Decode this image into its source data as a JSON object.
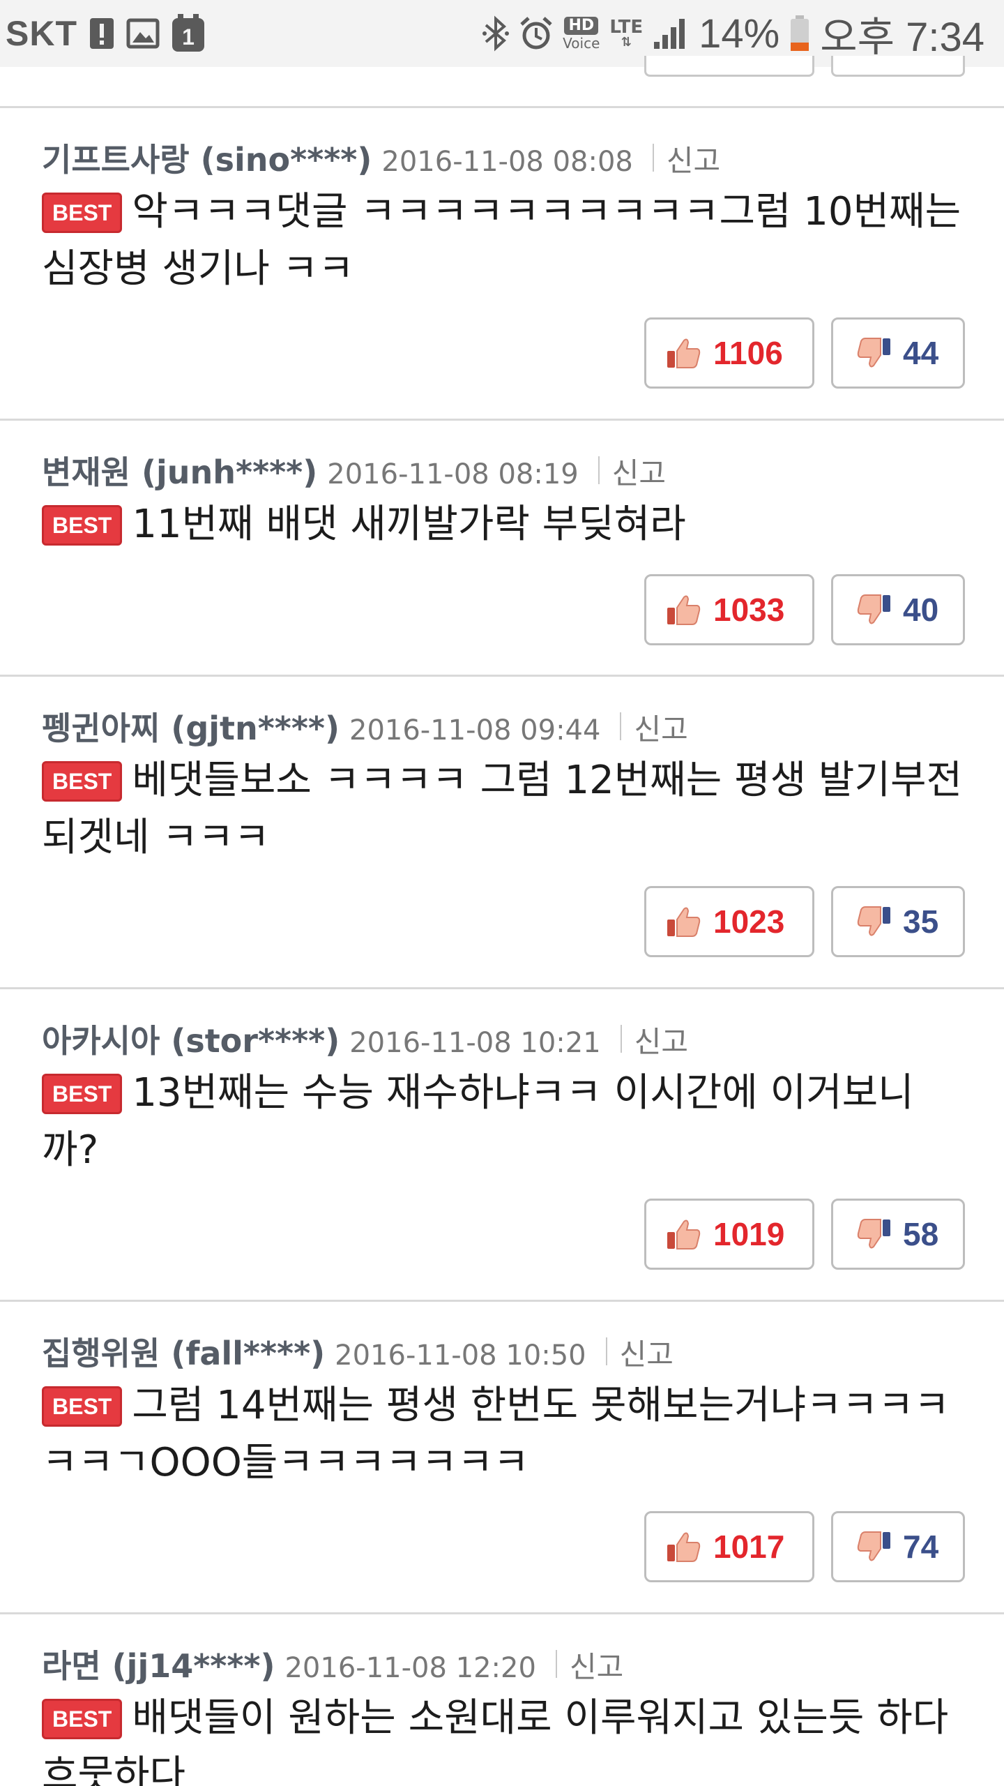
{
  "status_bar": {
    "carrier": "SKT",
    "battery_percent": "14%",
    "time": "오후 7:34",
    "hd_label": "HD",
    "voice_label": "Voice",
    "network_label": "LTE",
    "icons": [
      "warning-icon",
      "gallery-icon",
      "notification-icon",
      "bluetooth-icon",
      "alarm-icon",
      "signal-icon",
      "battery-icon"
    ]
  },
  "comments": [
    {
      "nick": "기프트사랑 (sino****)",
      "date": "2016-11-08 08:08",
      "report": "신고",
      "badge": "BEST",
      "text": "악ㅋㅋㅋ댓글 ㅋㅋㅋㅋㅋㅋㅋㅋㅋㅋ그럼 10번째는 심장병 생기나 ㅋㅋ",
      "likes": "1106",
      "dislikes": "44"
    },
    {
      "nick": "변재원 (junh****)",
      "date": "2016-11-08 08:19",
      "report": "신고",
      "badge": "BEST",
      "text": "11번째 배댓 새끼발가락 부딪혀라",
      "likes": "1033",
      "dislikes": "40"
    },
    {
      "nick": "펭귄아찌 (gjtn****)",
      "date": "2016-11-08 09:44",
      "report": "신고",
      "badge": "BEST",
      "text": "베댓들보소 ㅋㅋㅋㅋ 그럼 12번째는 평생 발기부전 되겟네 ㅋㅋㅋ",
      "likes": "1023",
      "dislikes": "35"
    },
    {
      "nick": "아카시아 (stor****)",
      "date": "2016-11-08 10:21",
      "report": "신고",
      "badge": "BEST",
      "text": "13번째는 수능 재수하냐ㅋㅋ 이시간에 이거보니까?",
      "likes": "1019",
      "dislikes": "58"
    },
    {
      "nick": "집행위원 (fall****)",
      "date": "2016-11-08 10:50",
      "report": "신고",
      "badge": "BEST",
      "text": "그럼 14번째는 평생 한번도 못해보는거냐ㅋㅋㅋㅋㅋㅋㄱOOO들ㅋㅋㅋㅋㅋㅋㅋ",
      "likes": "1017",
      "dislikes": "74"
    },
    {
      "nick": "라면 (jj14****)",
      "date": "2016-11-08 12:20",
      "report": "신고",
      "badge": "BEST",
      "text": "배댓들이 원하는 소원대로 이루워지고 있는듯 하다 흐뭇하다",
      "likes": "",
      "dislikes": ""
    }
  ],
  "colors": {
    "best_badge": "#e53a40",
    "like_count": "#e3262c",
    "dislike_count": "#3b4f8a",
    "status_bar_bg": "#f3f3f3"
  }
}
